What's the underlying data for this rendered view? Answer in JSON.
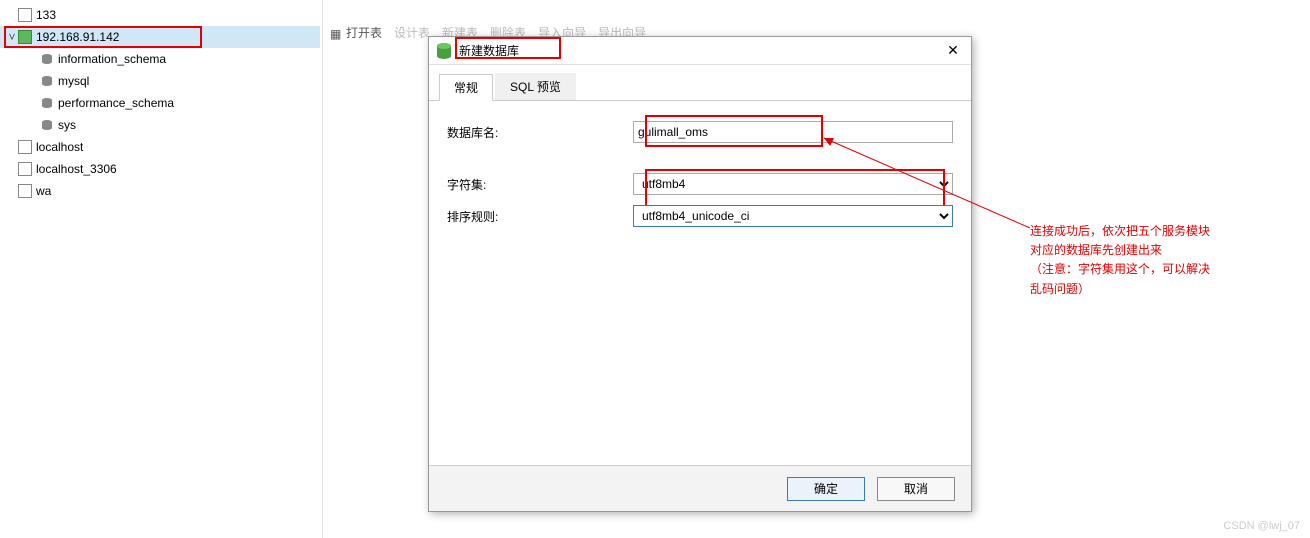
{
  "tree": {
    "items": [
      {
        "label": "133",
        "icon": "conn",
        "level": 1,
        "selected": false,
        "chevron": ""
      },
      {
        "label": "192.168.91.142",
        "icon": "conn-green",
        "level": 1,
        "selected": true,
        "chevron": "v"
      },
      {
        "label": "information_schema",
        "icon": "db",
        "level": 2,
        "selected": false
      },
      {
        "label": "mysql",
        "icon": "db",
        "level": 2,
        "selected": false
      },
      {
        "label": "performance_schema",
        "icon": "db",
        "level": 2,
        "selected": false
      },
      {
        "label": "sys",
        "icon": "db",
        "level": 2,
        "selected": false
      },
      {
        "label": "localhost",
        "icon": "conn",
        "level": 1,
        "selected": false
      },
      {
        "label": "localhost_3306",
        "icon": "conn",
        "level": 1,
        "selected": false
      },
      {
        "label": "wa",
        "icon": "conn",
        "level": 1,
        "selected": false
      }
    ]
  },
  "toolbar": {
    "open_table": "打开表",
    "design_table": "设计表",
    "new_table": "新建表",
    "delete_table": "删除表",
    "import_wizard": "导入向导",
    "export_wizard": "导出向导"
  },
  "dialog": {
    "title": "新建数据库",
    "tabs": {
      "general": "常规",
      "sql_preview": "SQL 预览"
    },
    "labels": {
      "db_name": "数据库名:",
      "charset": "字符集:",
      "collation": "排序规则:"
    },
    "values": {
      "db_name": "gulimall_oms",
      "charset": "utf8mb4",
      "collation": "utf8mb4_unicode_ci"
    },
    "buttons": {
      "ok": "确定",
      "cancel": "取消"
    }
  },
  "annotation": {
    "line1": "连接成功后，依次把五个服务模块",
    "line2": "对应的数据库先创建出来",
    "line3": "（注意：字符集用这个，可以解决",
    "line4": "乱码问题）"
  },
  "watermark": "CSDN @lwj_07"
}
